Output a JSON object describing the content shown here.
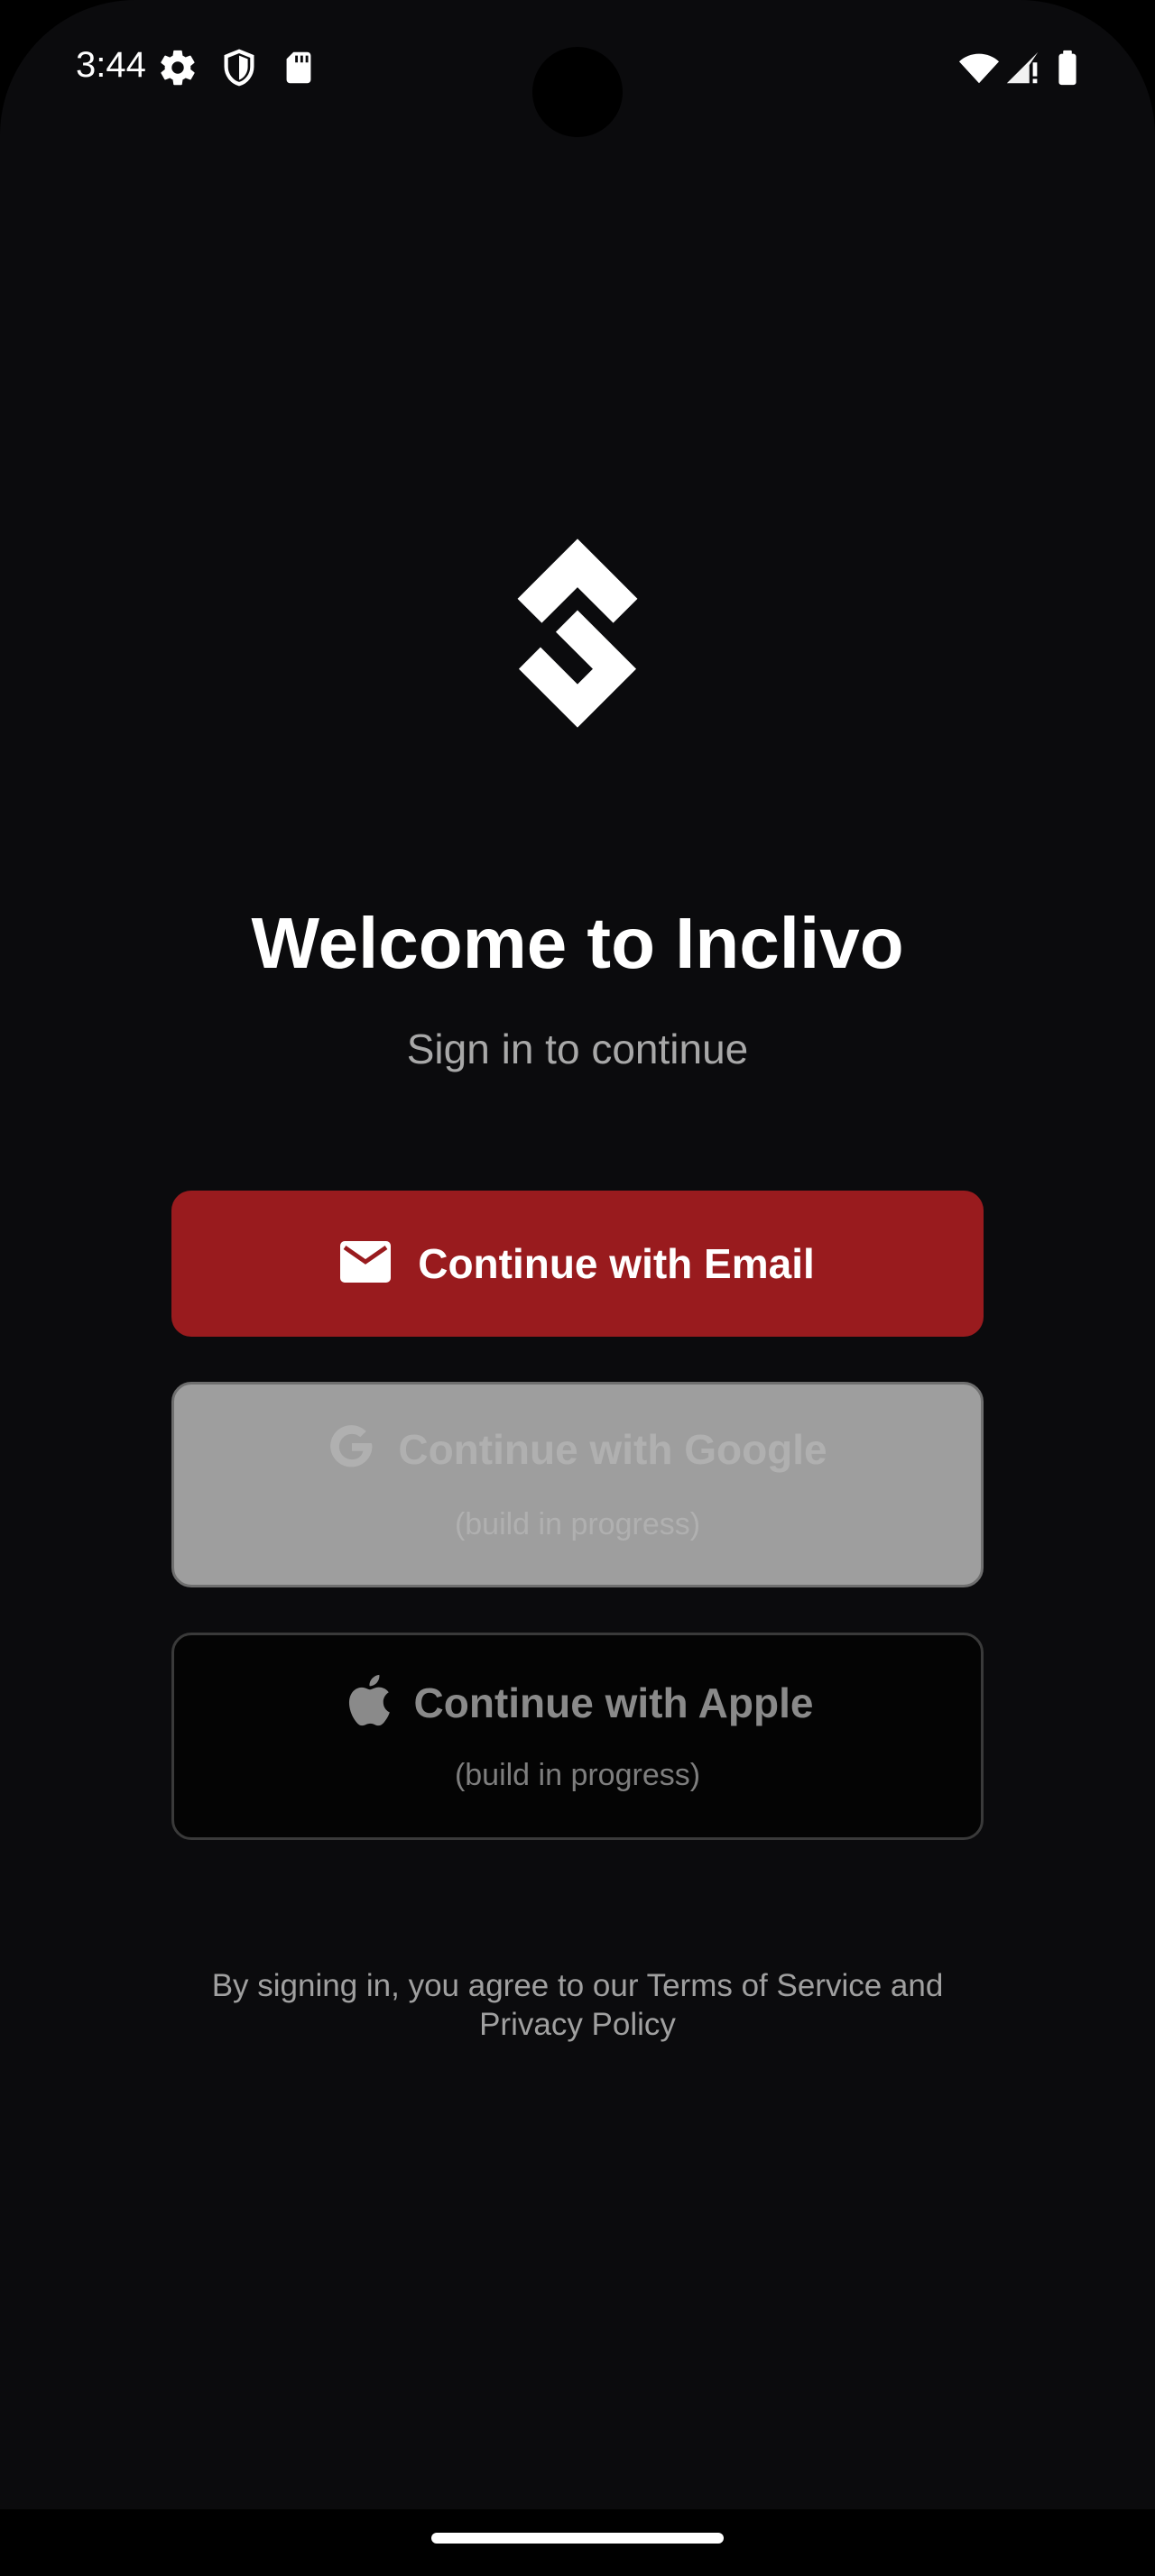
{
  "status_bar": {
    "time": "3:44",
    "left_icons": [
      "gear-icon",
      "shield-icon",
      "sd-card-icon"
    ],
    "right_icons": [
      "wifi-icon",
      "cell-signal-icon",
      "battery-icon"
    ]
  },
  "logo": {
    "icon": "inclivo-logo-icon"
  },
  "title": "Welcome to Inclivo",
  "subtitle": "Sign in to continue",
  "buttons": {
    "email": {
      "label": "Continue with Email",
      "icon": "mail-icon",
      "color": "#991b1e"
    },
    "google": {
      "label": "Continue with Google",
      "sublabel": "(build in progress)",
      "icon": "google-icon"
    },
    "apple": {
      "label": "Continue with Apple",
      "sublabel": "(build in progress)",
      "icon": "apple-icon"
    }
  },
  "terms": {
    "line1": "By signing in, you agree to our Terms of Service and",
    "line2": "Privacy Policy"
  }
}
